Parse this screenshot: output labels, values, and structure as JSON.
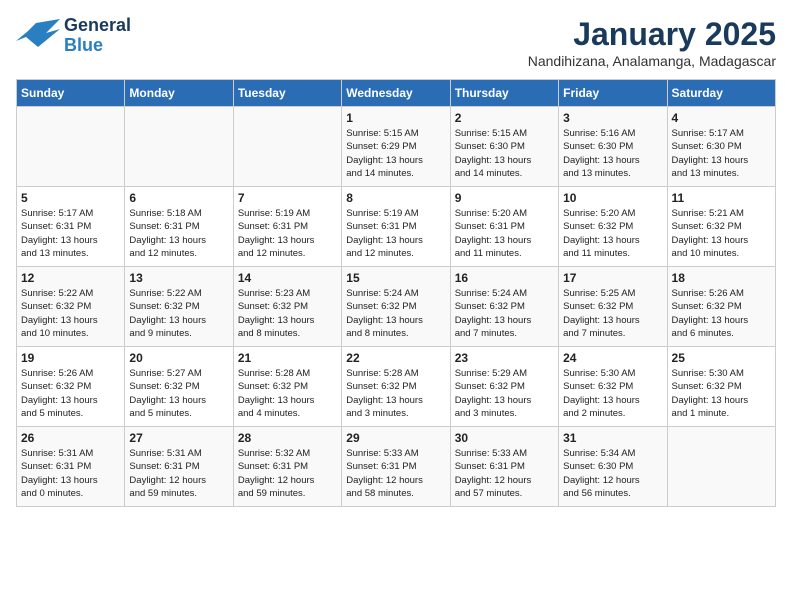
{
  "header": {
    "logo_general": "General",
    "logo_blue": "Blue",
    "month": "January 2025",
    "location": "Nandihizana, Analamanga, Madagascar"
  },
  "days_of_week": [
    "Sunday",
    "Monday",
    "Tuesday",
    "Wednesday",
    "Thursday",
    "Friday",
    "Saturday"
  ],
  "weeks": [
    [
      {
        "day": "",
        "info": ""
      },
      {
        "day": "",
        "info": ""
      },
      {
        "day": "",
        "info": ""
      },
      {
        "day": "1",
        "info": "Sunrise: 5:15 AM\nSunset: 6:29 PM\nDaylight: 13 hours\nand 14 minutes."
      },
      {
        "day": "2",
        "info": "Sunrise: 5:15 AM\nSunset: 6:30 PM\nDaylight: 13 hours\nand 14 minutes."
      },
      {
        "day": "3",
        "info": "Sunrise: 5:16 AM\nSunset: 6:30 PM\nDaylight: 13 hours\nand 13 minutes."
      },
      {
        "day": "4",
        "info": "Sunrise: 5:17 AM\nSunset: 6:30 PM\nDaylight: 13 hours\nand 13 minutes."
      }
    ],
    [
      {
        "day": "5",
        "info": "Sunrise: 5:17 AM\nSunset: 6:31 PM\nDaylight: 13 hours\nand 13 minutes."
      },
      {
        "day": "6",
        "info": "Sunrise: 5:18 AM\nSunset: 6:31 PM\nDaylight: 13 hours\nand 12 minutes."
      },
      {
        "day": "7",
        "info": "Sunrise: 5:19 AM\nSunset: 6:31 PM\nDaylight: 13 hours\nand 12 minutes."
      },
      {
        "day": "8",
        "info": "Sunrise: 5:19 AM\nSunset: 6:31 PM\nDaylight: 13 hours\nand 12 minutes."
      },
      {
        "day": "9",
        "info": "Sunrise: 5:20 AM\nSunset: 6:31 PM\nDaylight: 13 hours\nand 11 minutes."
      },
      {
        "day": "10",
        "info": "Sunrise: 5:20 AM\nSunset: 6:32 PM\nDaylight: 13 hours\nand 11 minutes."
      },
      {
        "day": "11",
        "info": "Sunrise: 5:21 AM\nSunset: 6:32 PM\nDaylight: 13 hours\nand 10 minutes."
      }
    ],
    [
      {
        "day": "12",
        "info": "Sunrise: 5:22 AM\nSunset: 6:32 PM\nDaylight: 13 hours\nand 10 minutes."
      },
      {
        "day": "13",
        "info": "Sunrise: 5:22 AM\nSunset: 6:32 PM\nDaylight: 13 hours\nand 9 minutes."
      },
      {
        "day": "14",
        "info": "Sunrise: 5:23 AM\nSunset: 6:32 PM\nDaylight: 13 hours\nand 8 minutes."
      },
      {
        "day": "15",
        "info": "Sunrise: 5:24 AM\nSunset: 6:32 PM\nDaylight: 13 hours\nand 8 minutes."
      },
      {
        "day": "16",
        "info": "Sunrise: 5:24 AM\nSunset: 6:32 PM\nDaylight: 13 hours\nand 7 minutes."
      },
      {
        "day": "17",
        "info": "Sunrise: 5:25 AM\nSunset: 6:32 PM\nDaylight: 13 hours\nand 7 minutes."
      },
      {
        "day": "18",
        "info": "Sunrise: 5:26 AM\nSunset: 6:32 PM\nDaylight: 13 hours\nand 6 minutes."
      }
    ],
    [
      {
        "day": "19",
        "info": "Sunrise: 5:26 AM\nSunset: 6:32 PM\nDaylight: 13 hours\nand 5 minutes."
      },
      {
        "day": "20",
        "info": "Sunrise: 5:27 AM\nSunset: 6:32 PM\nDaylight: 13 hours\nand 5 minutes."
      },
      {
        "day": "21",
        "info": "Sunrise: 5:28 AM\nSunset: 6:32 PM\nDaylight: 13 hours\nand 4 minutes."
      },
      {
        "day": "22",
        "info": "Sunrise: 5:28 AM\nSunset: 6:32 PM\nDaylight: 13 hours\nand 3 minutes."
      },
      {
        "day": "23",
        "info": "Sunrise: 5:29 AM\nSunset: 6:32 PM\nDaylight: 13 hours\nand 3 minutes."
      },
      {
        "day": "24",
        "info": "Sunrise: 5:30 AM\nSunset: 6:32 PM\nDaylight: 13 hours\nand 2 minutes."
      },
      {
        "day": "25",
        "info": "Sunrise: 5:30 AM\nSunset: 6:32 PM\nDaylight: 13 hours\nand 1 minute."
      }
    ],
    [
      {
        "day": "26",
        "info": "Sunrise: 5:31 AM\nSunset: 6:31 PM\nDaylight: 13 hours\nand 0 minutes."
      },
      {
        "day": "27",
        "info": "Sunrise: 5:31 AM\nSunset: 6:31 PM\nDaylight: 12 hours\nand 59 minutes."
      },
      {
        "day": "28",
        "info": "Sunrise: 5:32 AM\nSunset: 6:31 PM\nDaylight: 12 hours\nand 59 minutes."
      },
      {
        "day": "29",
        "info": "Sunrise: 5:33 AM\nSunset: 6:31 PM\nDaylight: 12 hours\nand 58 minutes."
      },
      {
        "day": "30",
        "info": "Sunrise: 5:33 AM\nSunset: 6:31 PM\nDaylight: 12 hours\nand 57 minutes."
      },
      {
        "day": "31",
        "info": "Sunrise: 5:34 AM\nSunset: 6:30 PM\nDaylight: 12 hours\nand 56 minutes."
      },
      {
        "day": "",
        "info": ""
      }
    ]
  ]
}
